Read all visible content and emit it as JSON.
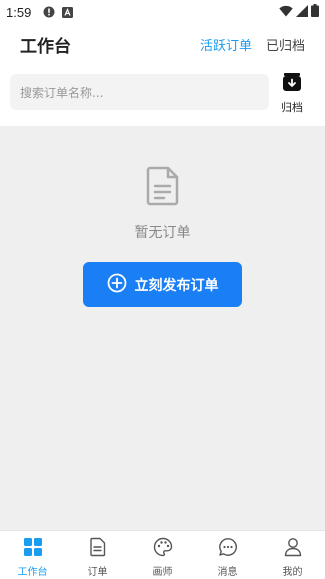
{
  "status_bar": {
    "time": "1:59"
  },
  "header": {
    "title": "工作台",
    "tabs": [
      {
        "label": "活跃订单",
        "active": true
      },
      {
        "label": "已归档",
        "active": false
      }
    ]
  },
  "search": {
    "placeholder": "搜索订单名称...",
    "value": ""
  },
  "archive": {
    "label": "归档",
    "icon": "archive-download-icon"
  },
  "empty_state": {
    "icon": "document-icon",
    "text": "暂无订单",
    "button_label": "立刻发布订单",
    "button_icon": "plus-circle-icon"
  },
  "bottom_nav": {
    "items": [
      {
        "label": "工作台",
        "icon": "grid-icon",
        "active": true
      },
      {
        "label": "订单",
        "icon": "document-icon",
        "active": false
      },
      {
        "label": "画师",
        "icon": "palette-icon",
        "active": false
      },
      {
        "label": "消息",
        "icon": "chat-icon",
        "active": false
      },
      {
        "label": "我的",
        "icon": "person-icon",
        "active": false
      }
    ]
  },
  "colors": {
    "accent": "#1a9cf0",
    "button": "#1a7ef5",
    "content_bg": "#efefef"
  }
}
